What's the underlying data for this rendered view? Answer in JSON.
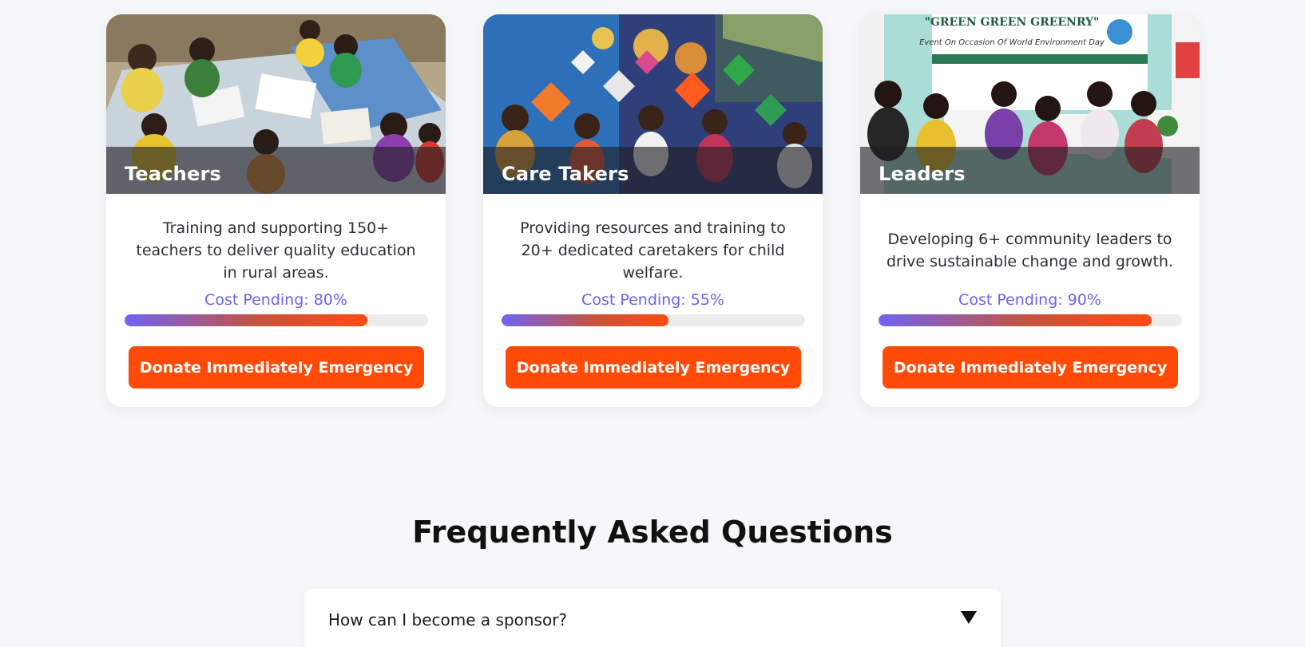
{
  "cards": [
    {
      "title": "Teachers",
      "description": "Training and supporting 150+ teachers to deliver quality education in rural areas.",
      "cost_label": "Cost Pending: 80%",
      "progress": 0.8,
      "button_label": "Donate Immediately Emergency"
    },
    {
      "title": "Care Takers",
      "description": "Providing resources and training to 20+ dedicated caretakers for child welfare.",
      "cost_label": "Cost Pending: 55%",
      "progress": 0.55,
      "button_label": "Donate Immediately Emergency"
    },
    {
      "title": "Leaders",
      "description": "Developing 6+ community leaders to drive sustainable change and growth.",
      "cost_label": "Cost Pending: 90%",
      "progress": 0.9,
      "button_label": "Donate Immediately Emergency"
    }
  ],
  "banner": {
    "line1": "\"GREEN GREEN GREENRY\"",
    "line2": "Event On Occasion Of World Environment Day"
  },
  "faq": {
    "heading": "Frequently Asked Questions",
    "items": [
      {
        "question": "How can I become a sponsor?",
        "icon": "triangle-down-icon"
      }
    ]
  },
  "colors": {
    "accent": "#ff4b07",
    "cost_text": "#6c63f0",
    "progress_start": "#6f63f3",
    "progress_end": "#ff4b10"
  }
}
